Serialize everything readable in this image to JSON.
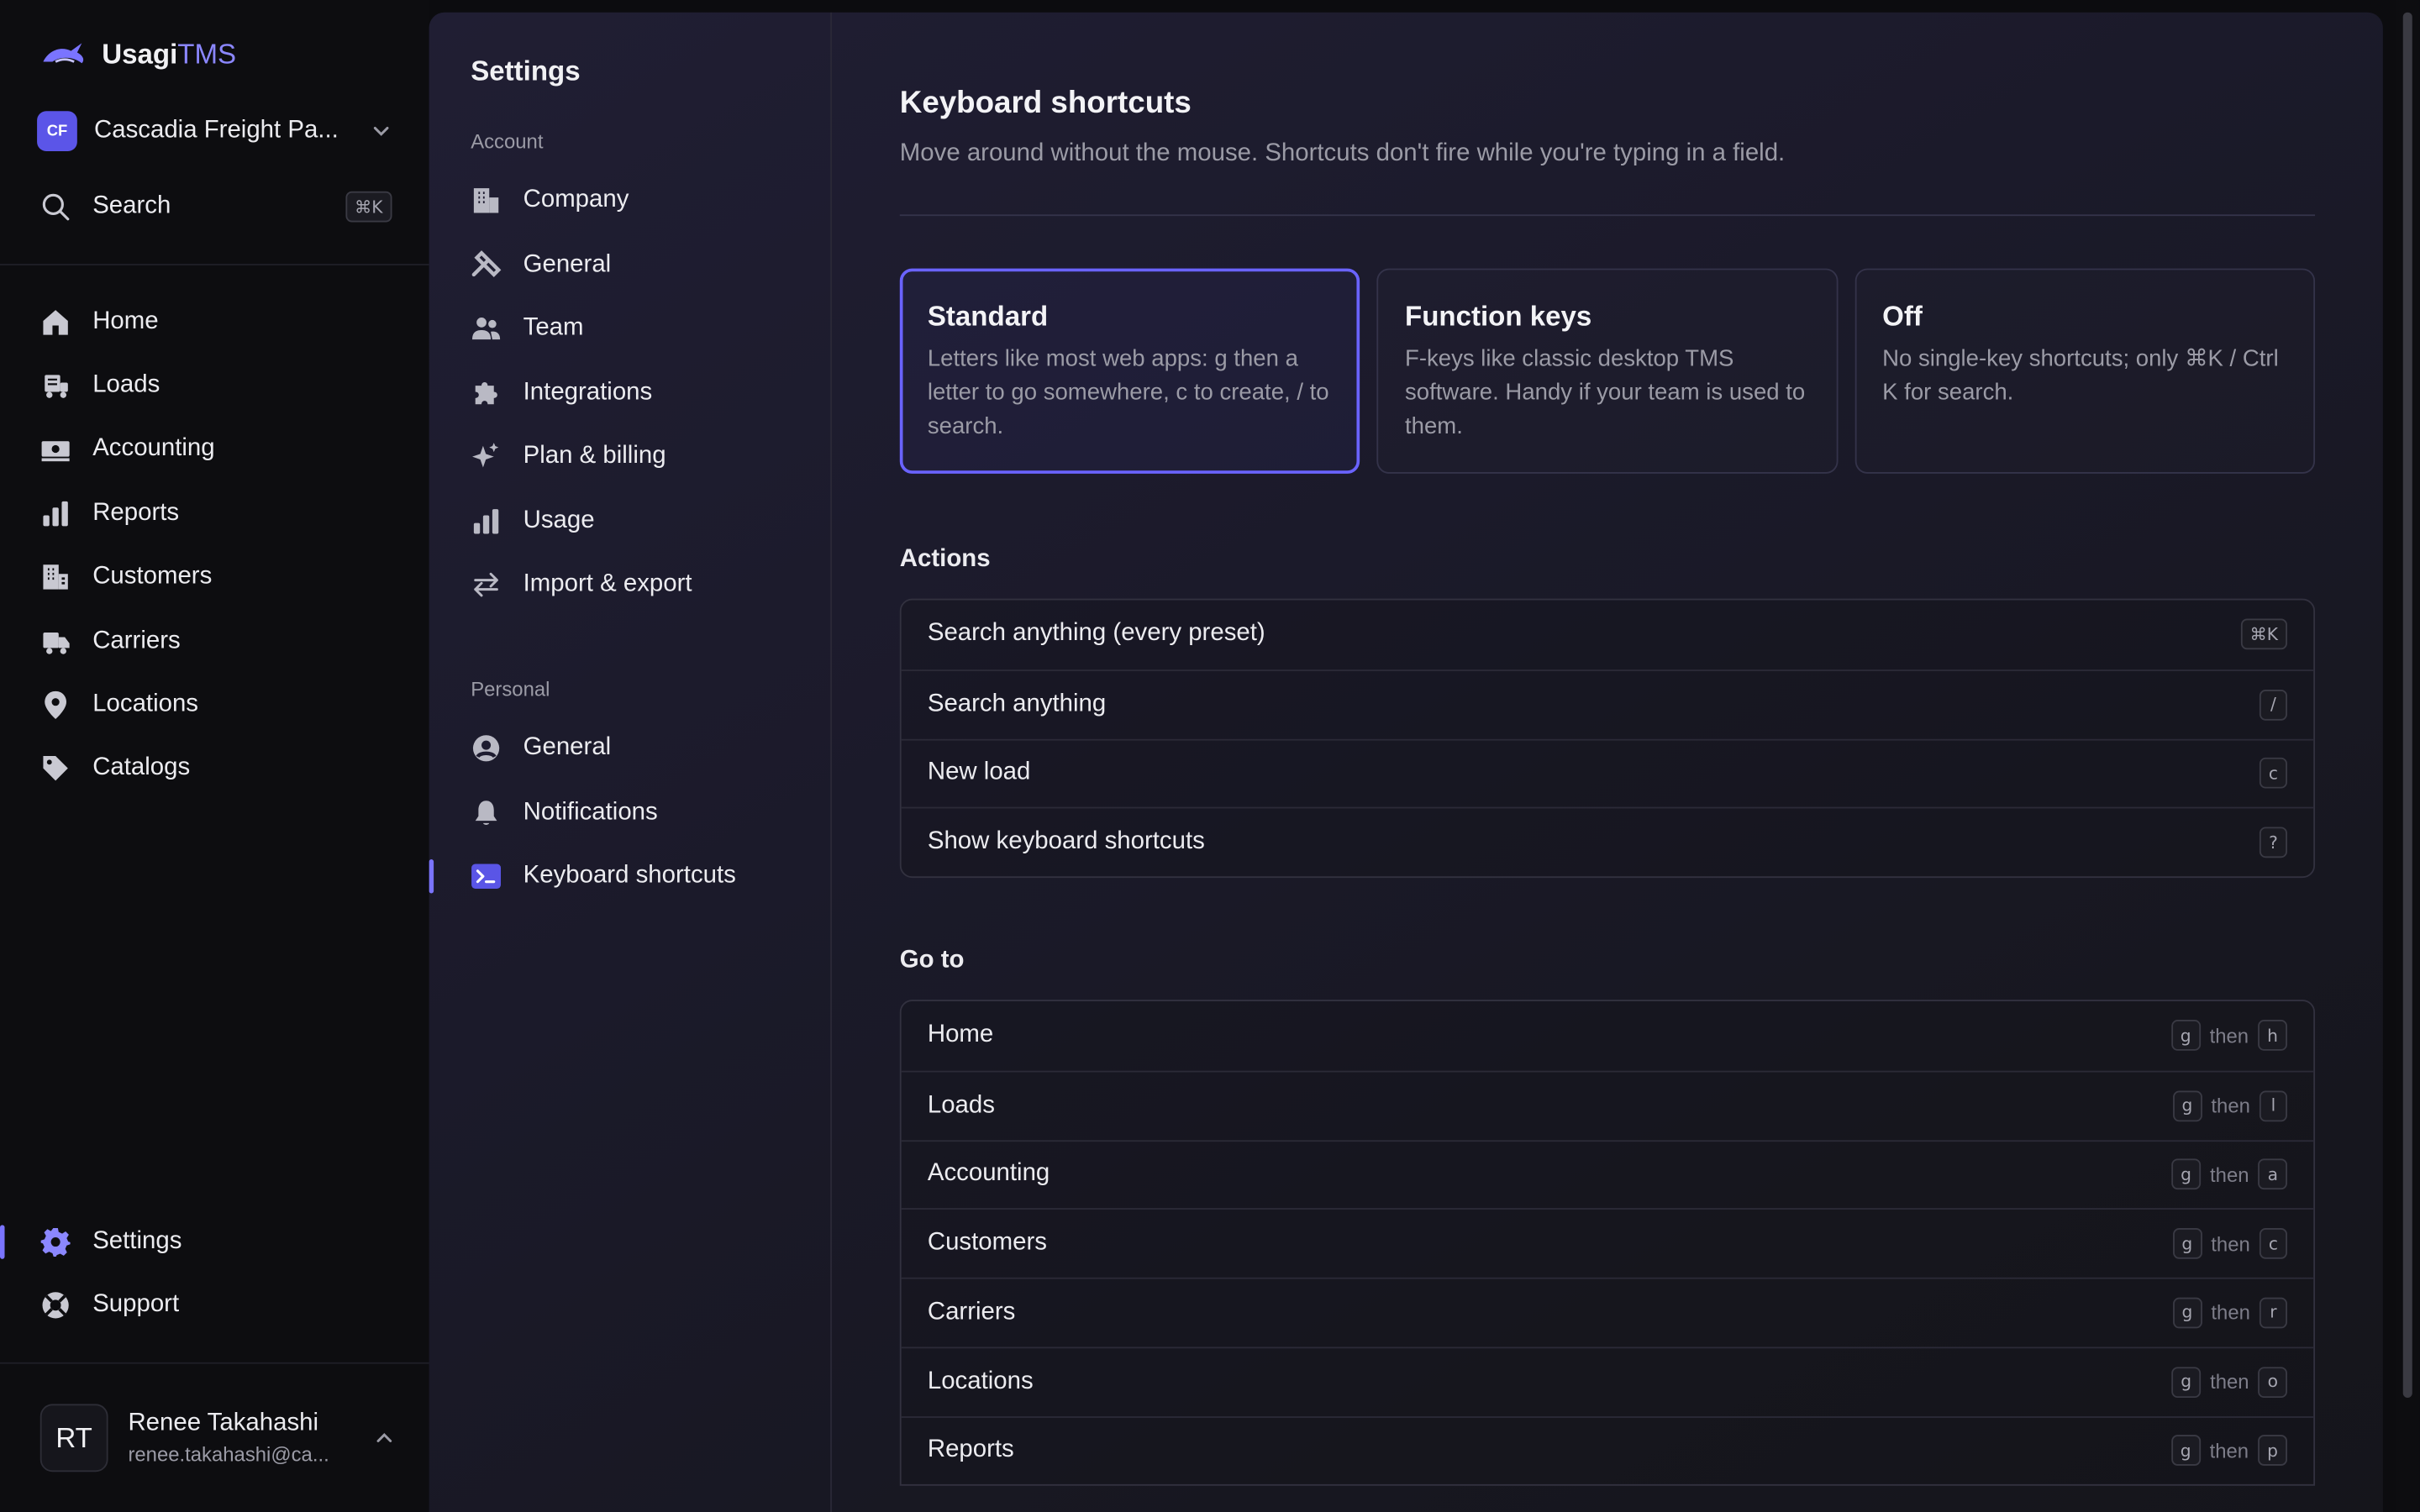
{
  "app": {
    "name_part1": "Usagi",
    "name_part2": "TMS"
  },
  "org": {
    "initials": "CF",
    "name": "Cascadia Freight Pa..."
  },
  "search": {
    "label": "Search",
    "shortcut": "⌘K"
  },
  "sidebar": {
    "items": [
      {
        "label": "Home",
        "icon": "home-icon"
      },
      {
        "label": "Loads",
        "icon": "truck-icon"
      },
      {
        "label": "Accounting",
        "icon": "money-icon"
      },
      {
        "label": "Reports",
        "icon": "bar-chart-icon"
      },
      {
        "label": "Customers",
        "icon": "building-icon"
      },
      {
        "label": "Carriers",
        "icon": "truck-icon"
      },
      {
        "label": "Locations",
        "icon": "map-pin-icon"
      },
      {
        "label": "Catalogs",
        "icon": "tag-icon"
      }
    ],
    "bottom": [
      {
        "label": "Settings",
        "icon": "gear-icon",
        "active": true
      },
      {
        "label": "Support",
        "icon": "lifebuoy-icon"
      }
    ]
  },
  "user": {
    "initials": "RT",
    "name": "Renee Takahashi",
    "email": "renee.takahashi@ca..."
  },
  "settings_nav": {
    "title": "Settings",
    "account_label": "Account",
    "account_items": [
      {
        "label": "Company",
        "icon": "building-icon"
      },
      {
        "label": "General",
        "icon": "wrench-icon"
      },
      {
        "label": "Team",
        "icon": "users-icon"
      },
      {
        "label": "Integrations",
        "icon": "puzzle-icon"
      },
      {
        "label": "Plan & billing",
        "icon": "sparkles-icon"
      },
      {
        "label": "Usage",
        "icon": "bar-chart-icon"
      },
      {
        "label": "Import & export",
        "icon": "arrows-icon"
      }
    ],
    "personal_label": "Personal",
    "personal_items": [
      {
        "label": "General",
        "icon": "user-circle-icon"
      },
      {
        "label": "Notifications",
        "icon": "bell-icon"
      },
      {
        "label": "Keyboard shortcuts",
        "icon": "terminal-icon",
        "active": true
      }
    ]
  },
  "page": {
    "title": "Keyboard shortcuts",
    "subtitle": "Move around without the mouse. Shortcuts don't fire while you're typing in a field.",
    "presets": [
      {
        "name": "Standard",
        "desc": "Letters like most web apps: g then a letter to go somewhere, c to create, / to search.",
        "selected": true
      },
      {
        "name": "Function keys",
        "desc": "F-keys like classic desktop TMS software. Handy if your team is used to them.",
        "selected": false
      },
      {
        "name": "Off",
        "desc": "No single-key shortcuts; only ⌘K / Ctrl K for search.",
        "selected": false
      }
    ],
    "actions_title": "Actions",
    "actions": [
      {
        "label": "Search anything (every preset)",
        "key": "⌘K"
      },
      {
        "label": "Search anything",
        "key": "/"
      },
      {
        "label": "New load",
        "key": "c"
      },
      {
        "label": "Show keyboard shortcuts",
        "key": "?"
      }
    ],
    "goto_title": "Go to",
    "then_word": "then",
    "goto": [
      {
        "label": "Home",
        "k1": "g",
        "k2": "h"
      },
      {
        "label": "Loads",
        "k1": "g",
        "k2": "l"
      },
      {
        "label": "Accounting",
        "k1": "g",
        "k2": "a"
      },
      {
        "label": "Customers",
        "k1": "g",
        "k2": "c"
      },
      {
        "label": "Carriers",
        "k1": "g",
        "k2": "r"
      },
      {
        "label": "Locations",
        "k1": "g",
        "k2": "o"
      },
      {
        "label": "Reports",
        "k1": "g",
        "k2": "p"
      }
    ]
  },
  "colors": {
    "accent": "#6a63ff",
    "org_badge": "#5b55e8",
    "bg": "#0c0c0f"
  }
}
